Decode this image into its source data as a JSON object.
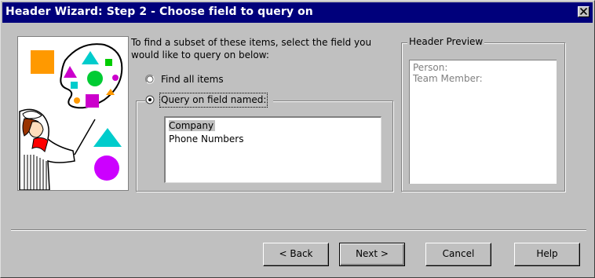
{
  "title": "Header Wizard: Step 2 - Choose field to query on",
  "instructions": "To find a subset of these items, select the field you would like to query on below:",
  "options": {
    "find_all": "Find all items",
    "query_field": "Query on field named:"
  },
  "selected_option": "query_field",
  "fields": {
    "items": [
      "Company",
      "Phone Numbers"
    ],
    "selected": "Company"
  },
  "preview": {
    "legend": "Header Preview",
    "lines": [
      "Person:",
      "Team Member:"
    ]
  },
  "buttons": {
    "back": "< Back",
    "next": "Next >",
    "cancel": "Cancel",
    "help": "Help"
  },
  "colors": {
    "title_bar": "#00007b",
    "face": "#c0c0c0",
    "preview_text": "#808080"
  }
}
